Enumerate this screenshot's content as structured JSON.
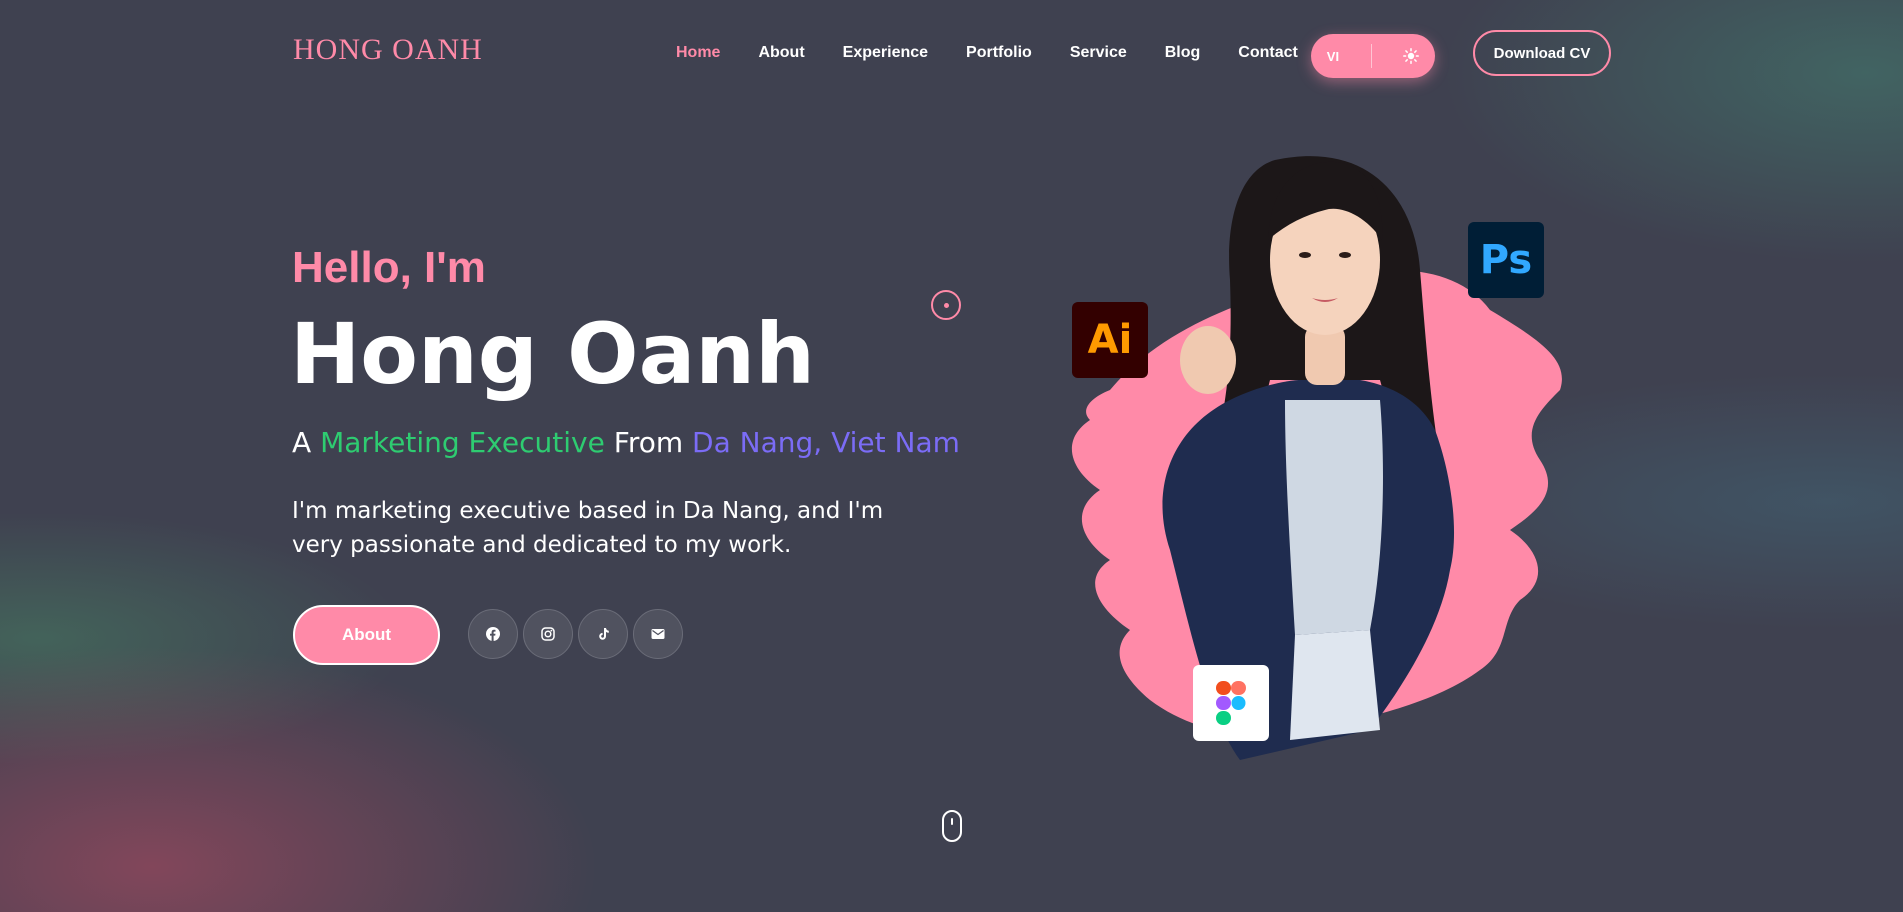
{
  "header": {
    "logo": "HONG OANH",
    "nav": [
      "Home",
      "About",
      "Experience",
      "Portfolio",
      "Service",
      "Blog",
      "Contact"
    ],
    "active_nav": "Home",
    "lang_label": "VI",
    "theme_icon": "sun-icon",
    "download_label": "Download CV"
  },
  "hero": {
    "greeting": "Hello, I'm",
    "name": "Hong Oanh",
    "tagline_prefix": "A",
    "tagline_role": "Marketing Executive",
    "tagline_mid": "From",
    "tagline_place": "Da Nang, Viet Nam",
    "description": "I'm marketing executive based in Da Nang, and I'm very passionate and dedicated to my work.",
    "about_label": "About",
    "socials": [
      "facebook-icon",
      "instagram-icon",
      "tiktok-icon",
      "mail-icon"
    ]
  },
  "badges": {
    "ai": "Ai",
    "ps": "Ps",
    "figma": "figma-icon"
  },
  "colors": {
    "background": "#3f4150",
    "accent": "#ff8aa8",
    "role": "#2ecc71",
    "place": "#7b6cf6"
  }
}
